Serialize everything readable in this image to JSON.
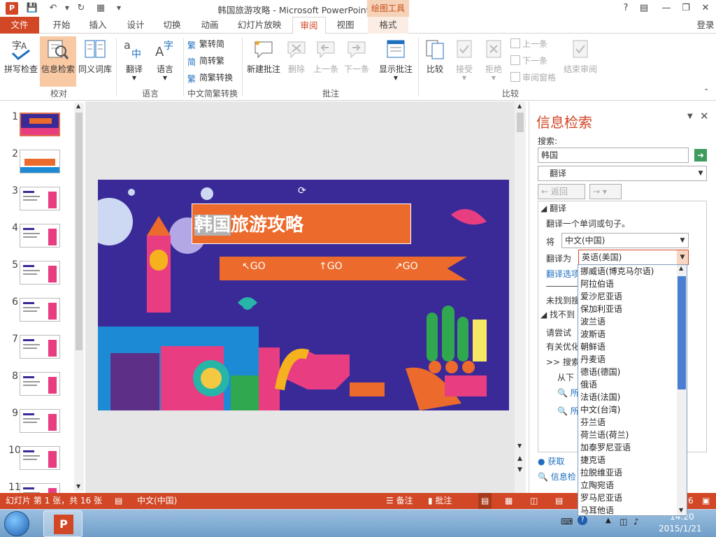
{
  "window": {
    "title": "韩国旅游攻略 - Microsoft PowerPoint",
    "context_tab": "绘图工具",
    "help": "?",
    "signin": "登录"
  },
  "tabs": [
    "文件",
    "开始",
    "插入",
    "设计",
    "切换",
    "动画",
    "幻灯片放映",
    "审阅",
    "视图",
    "格式"
  ],
  "ribbon": {
    "proofing": {
      "spelling": "拼写检查",
      "research": "信息检索",
      "thesaurus": "同义词库",
      "label": "校对"
    },
    "language": {
      "translate": "翻译",
      "language": "语言",
      "label": "语言"
    },
    "chinese_conversion": {
      "to_simplified": "繁转简",
      "to_traditional": "简转繁",
      "convert": "简繁转换",
      "label": "中文简繁转换"
    },
    "comments": {
      "new": "新建批注",
      "delete": "删除",
      "previous": "上一条",
      "next": "下一条",
      "show": "显示批注",
      "label": "批注"
    },
    "compare": {
      "compare": "比较",
      "accept": "接受",
      "reject": "拒绝",
      "prev": "上一条",
      "next": "下一条",
      "pane": "审阅窗格",
      "end": "结束审阅",
      "label": "比较"
    }
  },
  "slides": {
    "numbers": [
      "1",
      "2",
      "3",
      "4",
      "5",
      "6",
      "7",
      "8",
      "9",
      "10",
      "11"
    ],
    "selected": "1"
  },
  "slide": {
    "title_highlight": "韩国",
    "title_rest": "旅游攻略",
    "go1": "↖GO",
    "go2": "↑GO",
    "go3": "↗GO"
  },
  "pane": {
    "title": "信息检索",
    "search_label": "搜索:",
    "search_value": "韩国",
    "service": "翻译",
    "back": "返回",
    "section": "翻译",
    "desc": "翻译一个单词或句子。",
    "from_label": "将",
    "from_value": "中文(中国)",
    "to_label": "翻译为",
    "to_value": "英语(美国)",
    "options": "翻译选项",
    "not_found": "未找到搜",
    "not_found2": "找不到",
    "try": "请尝试",
    "related": "有关优化",
    "search_more": ">> 搜索",
    "from_below": "从下",
    "all1": "所",
    "all2": "所",
    "get": "获取",
    "research_options": "信息检"
  },
  "languages": [
    "挪威语(博克马尔语)",
    "阿拉伯语",
    "爱沙尼亚语",
    "保加利亚语",
    "波兰语",
    "波斯语",
    "朝鲜语",
    "丹麦语",
    "德语(德国)",
    "俄语",
    "法语(法国)",
    "中文(台湾)",
    "芬兰语",
    "荷兰语(荷兰)",
    "加泰罗尼亚语",
    "捷克语",
    "拉脱维亚语",
    "立陶宛语",
    "罗马尼亚语",
    "马耳他语"
  ],
  "status": {
    "slide_info": "幻灯片 第 1 张，共 16 张",
    "lang": "中文(中国)",
    "notes": "备注",
    "comments": "批注",
    "zoom_tail": "6"
  },
  "taskbar": {
    "time": "14:20",
    "date": "2015/1/21"
  },
  "colors": {
    "accent": "#d24726",
    "slide_bg": "#3a2a97",
    "banner": "#ec6a2c"
  }
}
